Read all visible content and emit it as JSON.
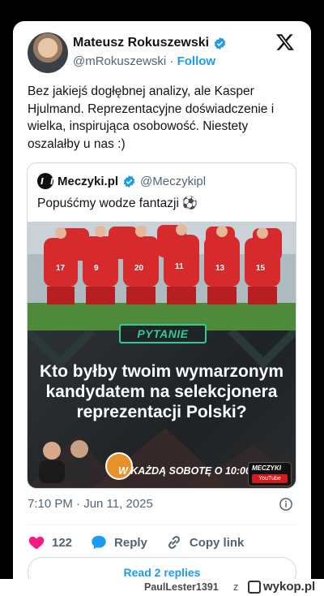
{
  "tweet": {
    "author_name": "Mateusz Rokuszewski",
    "author_handle": "@mRokuszewski",
    "separator": "·",
    "follow_label": "Follow",
    "text": "Bez jakiejś dogłębnej analizy, ale Kasper Hjulmand. Reprezentacyjne doświadczenie i wielka, inspirująca osobowość. Niestety oszalałby u nas :)",
    "timestamp": "7:10 PM · Jun 11, 2025",
    "likes": "122",
    "reply_label": "Reply",
    "copy_link_label": "Copy link",
    "read_more_label": "Read 2 replies"
  },
  "quote": {
    "author_name": "Meczyki.pl",
    "author_handle": "@Meczykipl",
    "text": "Popuśćmy wodze fantazji",
    "emoji": "⚽",
    "graphic": {
      "tag": "PYTANIE",
      "question": "Kto byłby twoim wymarzonym kandydatem na selekcjonera reprezentacji Polski?",
      "schedule": "W KAŻDĄ SOBOTĘ O 10:00",
      "brand": "MECZYKI",
      "brand_sub": "YouTube"
    }
  },
  "footer": {
    "username": "PaulLester1391",
    "z": "z",
    "site": "wykop.pl"
  },
  "colors": {
    "accent": "#1d9bf0",
    "like": "#f91880",
    "reply": "#1d9bf0",
    "pytanie": "#2ecc93",
    "jersey": "#d62a2d"
  },
  "icons": [
    "verified-badge-icon",
    "x-logo-icon",
    "info-icon",
    "heart-icon",
    "reply-bubble-icon",
    "link-icon",
    "football-icon"
  ]
}
